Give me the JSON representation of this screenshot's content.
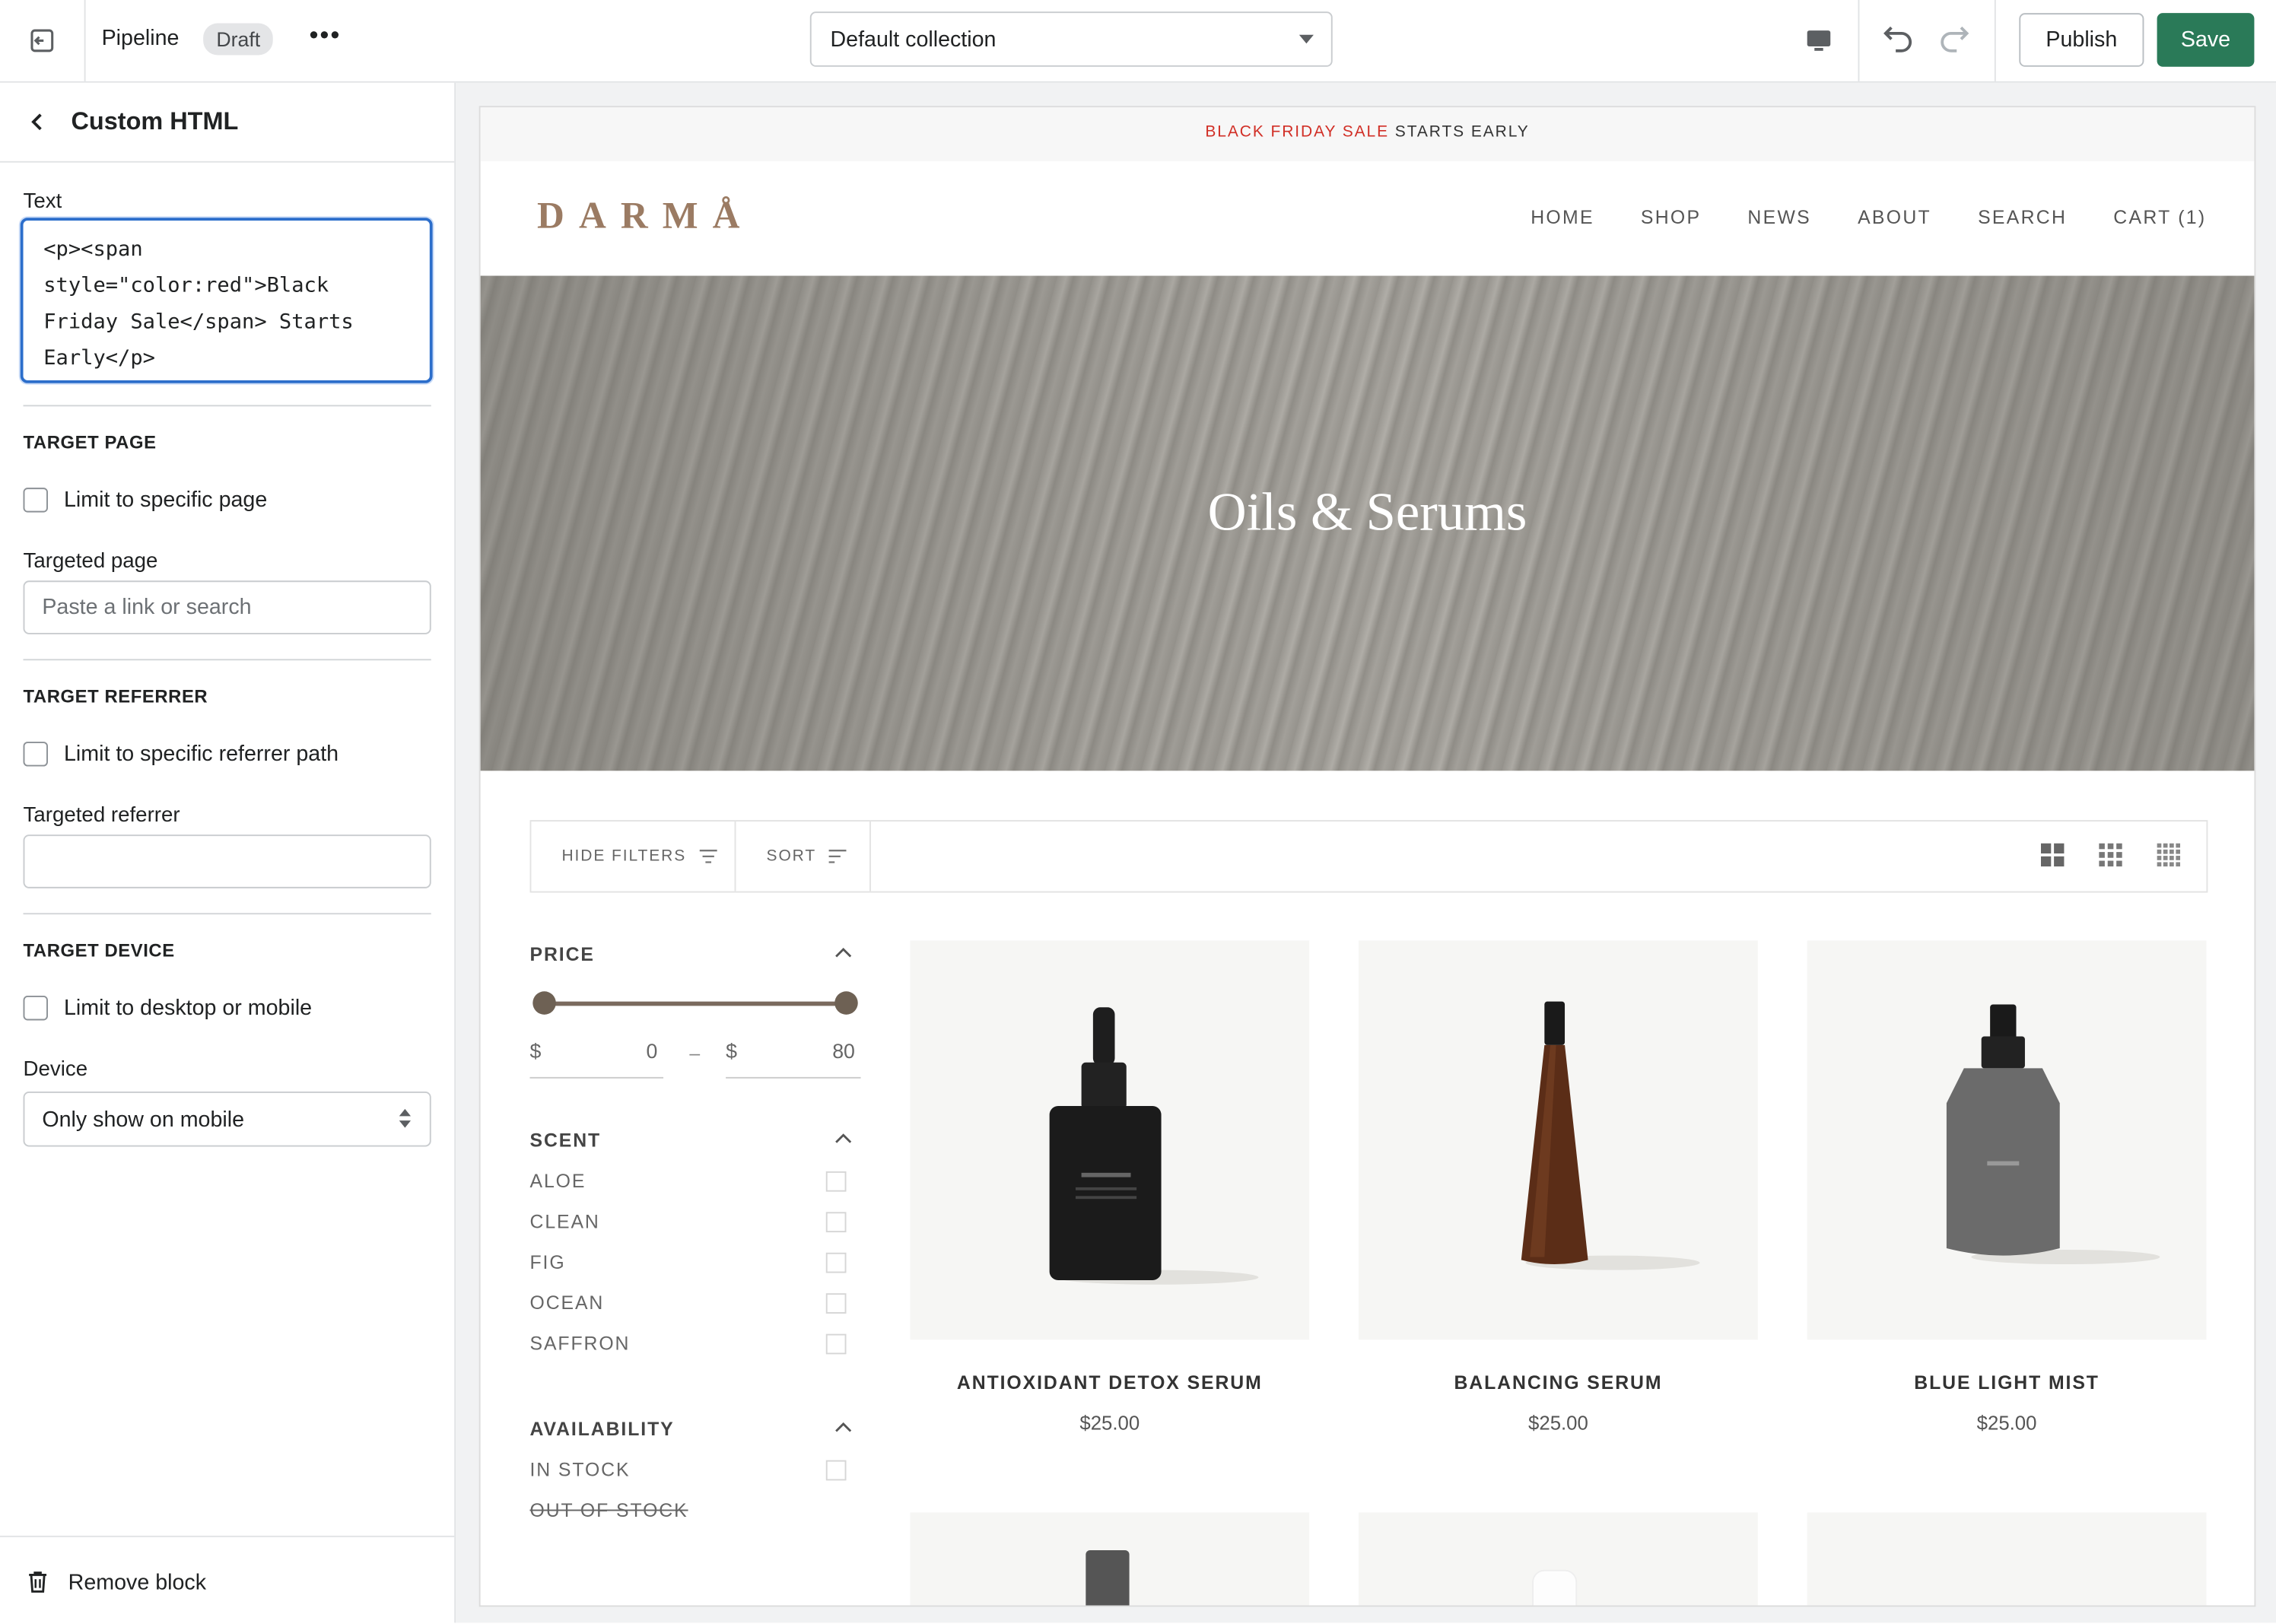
{
  "topbar": {
    "name": "Pipeline",
    "badge": "Draft",
    "more": "•••",
    "collection": "Default collection",
    "publish_label": "Publish",
    "save_label": "Save"
  },
  "sidebar": {
    "title": "Custom HTML",
    "text_label": "Text",
    "text_value": "<p><span style=\"color:red\">Black Friday Sale</span> Starts Early</p>",
    "target_page": {
      "heading": "TARGET PAGE",
      "checkbox_label": "Limit to specific page",
      "field_label": "Targeted page",
      "placeholder": "Paste a link or search"
    },
    "target_referrer": {
      "heading": "TARGET REFERRER",
      "checkbox_label": "Limit to specific referrer path",
      "field_label": "Targeted referrer",
      "placeholder": ""
    },
    "target_device": {
      "heading": "TARGET DEVICE",
      "checkbox_label": "Limit to desktop or mobile",
      "field_label": "Device",
      "selected": "Only show on mobile"
    },
    "remove_label": "Remove block"
  },
  "store": {
    "announce_red": "BLACK FRIDAY SALE",
    "announce_rest": "STARTS EARLY",
    "logo": "DARMÅ",
    "nav": [
      "HOME",
      "SHOP",
      "NEWS",
      "ABOUT",
      "SEARCH",
      "CART (1)"
    ],
    "hero_title": "Oils & Serums",
    "hide_filters": "HIDE FILTERS",
    "sort": "SORT",
    "filters": {
      "price_heading": "PRICE",
      "currency": "$",
      "price_min": "0",
      "price_max": "80",
      "dash": "–",
      "scent_heading": "SCENT",
      "scents": [
        "ALOE",
        "CLEAN",
        "FIG",
        "OCEAN",
        "SAFFRON"
      ],
      "availability_heading": "AVAILABILITY",
      "in_stock": "IN STOCK",
      "out_of_stock": "OUT OF STOCK"
    },
    "products": [
      {
        "name": "ANTIOXIDANT DETOX SERUM",
        "price": "$25.00"
      },
      {
        "name": "BALANCING SERUM",
        "price": "$25.00"
      },
      {
        "name": "BLUE LIGHT MIST",
        "price": "$25.00"
      }
    ]
  },
  "colors": {
    "accent_green": "#2a7a58",
    "focus_blue": "#2c6ecb",
    "sale_red": "#d12f26",
    "logo_brown": "#9b7b63"
  }
}
